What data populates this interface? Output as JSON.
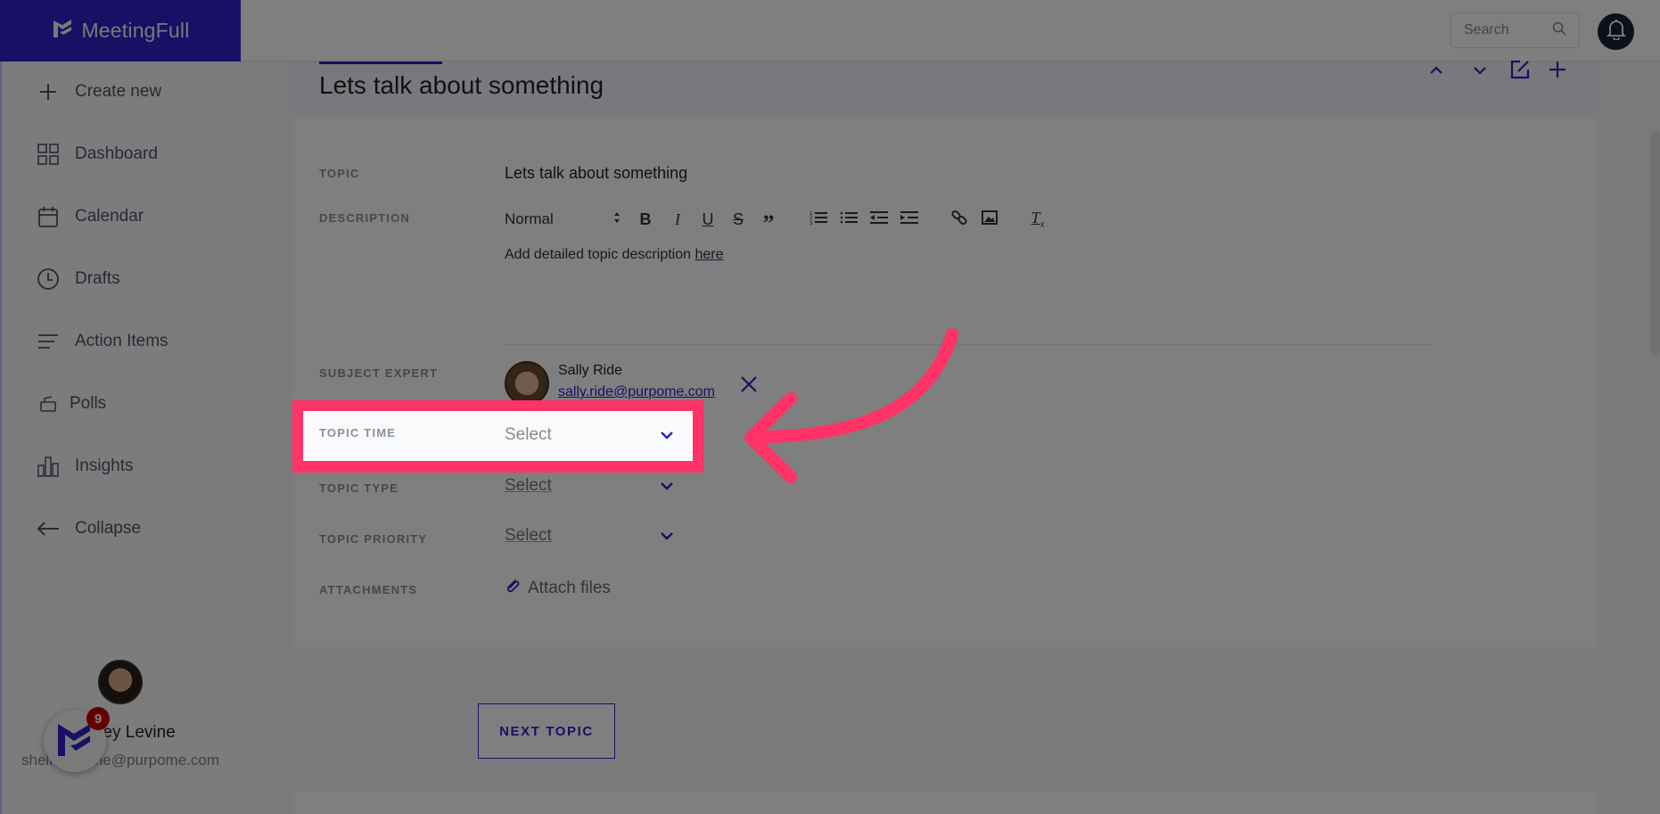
{
  "app": {
    "brand_name": "MeetingFull",
    "search_placeholder": "Search"
  },
  "sidebar": {
    "items": [
      {
        "label": "Create new",
        "icon": "plus-icon"
      },
      {
        "label": "Dashboard",
        "icon": "grid-icon"
      },
      {
        "label": "Calendar",
        "icon": "calendar-icon"
      },
      {
        "label": "Drafts",
        "icon": "clock-icon"
      },
      {
        "label": "Action Items",
        "icon": "list-icon"
      },
      {
        "label": "Polls",
        "icon": "ballot-icon"
      },
      {
        "label": "Insights",
        "icon": "bar-chart-icon"
      },
      {
        "label": "Collapse",
        "icon": "arrow-left-icon"
      }
    ],
    "user": {
      "name": "Shelley Levine",
      "email": "shelley.levine@purpome.com"
    },
    "notification_count": "9"
  },
  "topic": {
    "title": "Lets talk about something",
    "fields": {
      "topic_label": "TOPIC",
      "topic_value": "Lets talk about something",
      "description_label": "DESCRIPTION",
      "description_format": "Normal",
      "description_text": "Add detailed topic description ",
      "description_link": "here",
      "subject_expert_label": "SUBJECT EXPERT",
      "expert_name": "Sally Ride",
      "expert_email": "sally.ride@purpome.com",
      "topic_time_label": "TOPIC TIME",
      "topic_time_value": "Select",
      "topic_type_label": "TOPIC TYPE",
      "topic_type_value": "Select",
      "topic_priority_label": "TOPIC PRIORITY",
      "topic_priority_value": "Select",
      "attachments_label": "ATTACHMENTS",
      "attach_files": "Attach files"
    },
    "toolbar_icons": [
      "bold-icon",
      "italic-icon",
      "underline-icon",
      "strikethrough-icon",
      "blockquote-icon",
      "ordered-list-icon",
      "bullet-list-icon",
      "outdent-icon",
      "indent-icon",
      "link-icon",
      "image-icon",
      "clear-format-icon"
    ]
  },
  "actions": {
    "next_topic": "NEXT TOPIC"
  },
  "colors": {
    "brand": "#2f21c9",
    "highlight": "#ff3366",
    "badge": "#cc0000"
  }
}
